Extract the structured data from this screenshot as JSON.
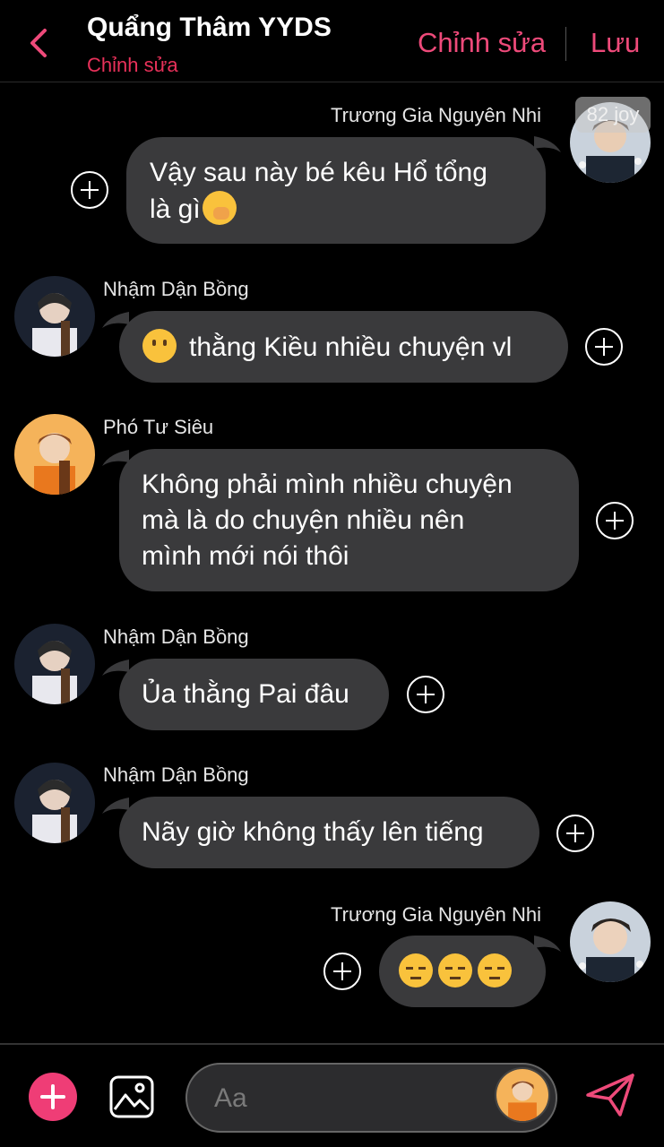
{
  "header": {
    "title": "Quẩng Thâm YYDS",
    "subtitle": "Chỉnh sửa",
    "edit_label": "Chỉnh sửa",
    "save_label": "Lưu"
  },
  "badge": "82 joy",
  "messages": [
    {
      "sender": "Trương Gia Nguyên Nhi",
      "side": "right",
      "line1": "Vậy sau này bé kêu Hổ tổng",
      "line2": "là gì"
    },
    {
      "sender": "Nhậm Dận Bồng",
      "side": "left",
      "text": "thằng Kiều nhiều chuyện vl"
    },
    {
      "sender": "Phó Tư Siêu",
      "side": "left",
      "line1": "Không phải mình nhiều chuyện",
      "line2": "mà là do chuyện nhiều nên",
      "line3": "mình mới nói thôi"
    },
    {
      "sender": "Nhậm Dận Bồng",
      "side": "left",
      "text": "Ủa thằng Pai đâu"
    },
    {
      "sender": "Nhậm Dận Bồng",
      "side": "left",
      "text": "Nãy giờ không thấy lên tiếng"
    },
    {
      "sender": "Trương Gia Nguyên Nhi",
      "side": "right",
      "text": ""
    }
  ],
  "composer": {
    "placeholder": "Aa"
  },
  "colors": {
    "accent": "#ef3d76",
    "header_buttons": "#ee4a7a",
    "subtitle": "#e8315a",
    "bubble": "#3a3a3c"
  }
}
